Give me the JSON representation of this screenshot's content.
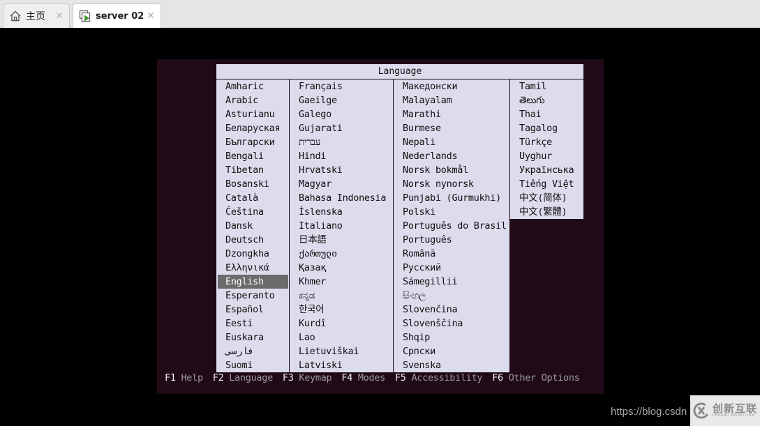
{
  "tabs": [
    {
      "label": "主页",
      "icon": "home-icon",
      "active": false
    },
    {
      "label": "server 02",
      "icon": "vm-icon",
      "active": true
    }
  ],
  "tab_close_glyph": "✕",
  "panel": {
    "title": "Language",
    "selected": "English",
    "columns": [
      [
        "Amharic",
        "Arabic",
        "Asturianu",
        "Беларуская",
        "Български",
        "Bengali",
        "Tibetan",
        "Bosanski",
        "Català",
        "Čeština",
        "Dansk",
        "Deutsch",
        "Dzongkha",
        "Ελληνικά",
        "English",
        "Esperanto",
        "Español",
        "Eesti",
        "Euskara",
        "فارسی",
        "Suomi"
      ],
      [
        "Français",
        "Gaeilge",
        "Galego",
        "Gujarati",
        "עברית",
        "Hindi",
        "Hrvatski",
        "Magyar",
        "Bahasa Indonesia",
        "Íslenska",
        "Italiano",
        "日本語",
        "ქართული",
        "Қазақ",
        "Khmer",
        "ಕನ್ನಡ",
        "한국어",
        "Kurdî",
        "Lao",
        "Lietuviškai",
        "Latviski"
      ],
      [
        "Македонски",
        "Malayalam",
        "Marathi",
        "Burmese",
        "Nepali",
        "Nederlands",
        "Norsk bokmål",
        "Norsk nynorsk",
        "Punjabi (Gurmukhi)",
        "Polski",
        "Português do Brasil",
        "Português",
        "Română",
        "Русский",
        "Sámegillii",
        "සිංහල",
        "Slovenčina",
        "Slovenščina",
        "Shqip",
        "Српски",
        "Svenska"
      ],
      [
        "Tamil",
        "తెలుగు",
        "Thai",
        "Tagalog",
        "Türkçe",
        "Uyghur",
        "Українська",
        "Tiếng Việt",
        "中文(简体)",
        "中文(繁體)"
      ]
    ]
  },
  "footer": [
    {
      "key": "F1",
      "action": "Help"
    },
    {
      "key": "F2",
      "action": "Language"
    },
    {
      "key": "F3",
      "action": "Keymap"
    },
    {
      "key": "F4",
      "action": "Modes"
    },
    {
      "key": "F5",
      "action": "Accessibility"
    },
    {
      "key": "F6",
      "action": "Other Options"
    }
  ],
  "watermark": {
    "url": "https://blog.csdn",
    "brand_cn": "创新互联",
    "brand_en": "CHUANG XIN HU LIAN"
  },
  "colors": {
    "console_bg": "#200a18",
    "panel_bg": "#dcdcec",
    "selected_bg": "#6b6b6b"
  }
}
